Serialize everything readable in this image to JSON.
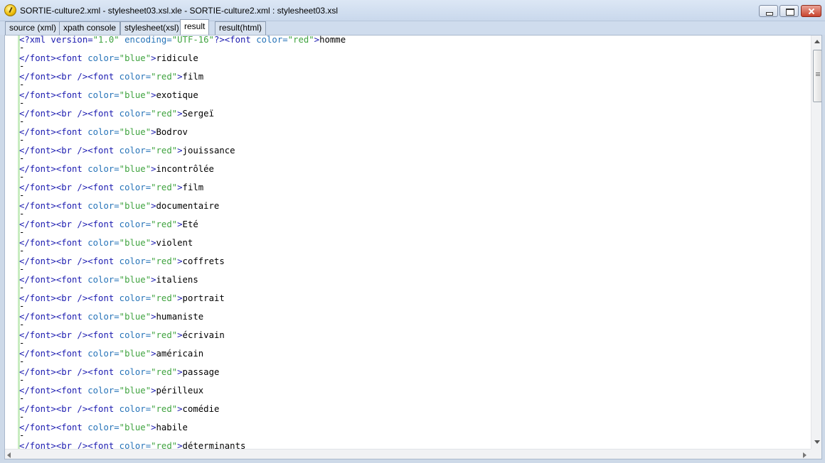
{
  "window": {
    "title": "SORTIE-culture2.xml - stylesheet03.xsl.xle - SORTIE-culture2.xml : stylesheet03.xsl"
  },
  "tabs": [
    {
      "label": "source (xml)",
      "active": false
    },
    {
      "label": "xpath console",
      "active": false
    },
    {
      "label": "stylesheet(xsl)",
      "active": false
    },
    {
      "label": "result",
      "active": true
    },
    {
      "label": "result(html)",
      "active": false
    }
  ],
  "editor": {
    "first_line": {
      "decl_open": "<?xml version=",
      "version": "\"1.0\"",
      "enc_attr": " encoding=",
      "encoding": "\"UTF-16\"",
      "decl_close": "?>",
      "font_open": "<font",
      "color_attr": " color=",
      "color_value": "\"red\"",
      "gt": ">",
      "text": "homme"
    },
    "lines": [
      {
        "pre": "</font><font",
        "post": "",
        "color": "\"blue\"",
        "text": "ridicule"
      },
      {
        "pre": "</font><br />",
        "post": "<font",
        "color": "\"red\"",
        "text": "film"
      },
      {
        "pre": "</font><font",
        "post": "",
        "color": "\"blue\"",
        "text": "exotique"
      },
      {
        "pre": "</font><br />",
        "post": "<font",
        "color": "\"red\"",
        "text": "Sergeï"
      },
      {
        "pre": "</font><font",
        "post": "",
        "color": "\"blue\"",
        "text": "Bodrov"
      },
      {
        "pre": "</font><br />",
        "post": "<font",
        "color": "\"red\"",
        "text": "jouissance"
      },
      {
        "pre": "</font><font",
        "post": "",
        "color": "\"blue\"",
        "text": "incontrôlée"
      },
      {
        "pre": "</font><br />",
        "post": "<font",
        "color": "\"red\"",
        "text": "film"
      },
      {
        "pre": "</font><font",
        "post": "",
        "color": "\"blue\"",
        "text": "documentaire"
      },
      {
        "pre": "</font><br />",
        "post": "<font",
        "color": "\"red\"",
        "text": "Eté"
      },
      {
        "pre": "</font><font",
        "post": "",
        "color": "\"blue\"",
        "text": "violent"
      },
      {
        "pre": "</font><br />",
        "post": "<font",
        "color": "\"red\"",
        "text": "coffrets"
      },
      {
        "pre": "</font><font",
        "post": "",
        "color": "\"blue\"",
        "text": "italiens"
      },
      {
        "pre": "</font><br />",
        "post": "<font",
        "color": "\"red\"",
        "text": "portrait"
      },
      {
        "pre": "</font><font",
        "post": "",
        "color": "\"blue\"",
        "text": "humaniste"
      },
      {
        "pre": "</font><br />",
        "post": "<font",
        "color": "\"red\"",
        "text": "écrivain"
      },
      {
        "pre": "</font><font",
        "post": "",
        "color": "\"blue\"",
        "text": "américain"
      },
      {
        "pre": "</font><br />",
        "post": "<font",
        "color": "\"red\"",
        "text": "passage"
      },
      {
        "pre": "</font><font",
        "post": "",
        "color": "\"blue\"",
        "text": "périlleux"
      },
      {
        "pre": "</font><br />",
        "post": "<font",
        "color": "\"red\"",
        "text": "comédie"
      },
      {
        "pre": "</font><font",
        "post": "",
        "color": "\"blue\"",
        "text": "habile"
      },
      {
        "pre": "</font><br />",
        "post": "<font",
        "color": "\"red\"",
        "text": "déterminants"
      }
    ],
    "color_attr": " color=",
    "gt": ">",
    "continuation": "-"
  },
  "colors": {
    "tag": "#1b1bb0",
    "attribute": "#2673b8",
    "value": "#3fa33f",
    "gutter": "#c8ecc0"
  }
}
